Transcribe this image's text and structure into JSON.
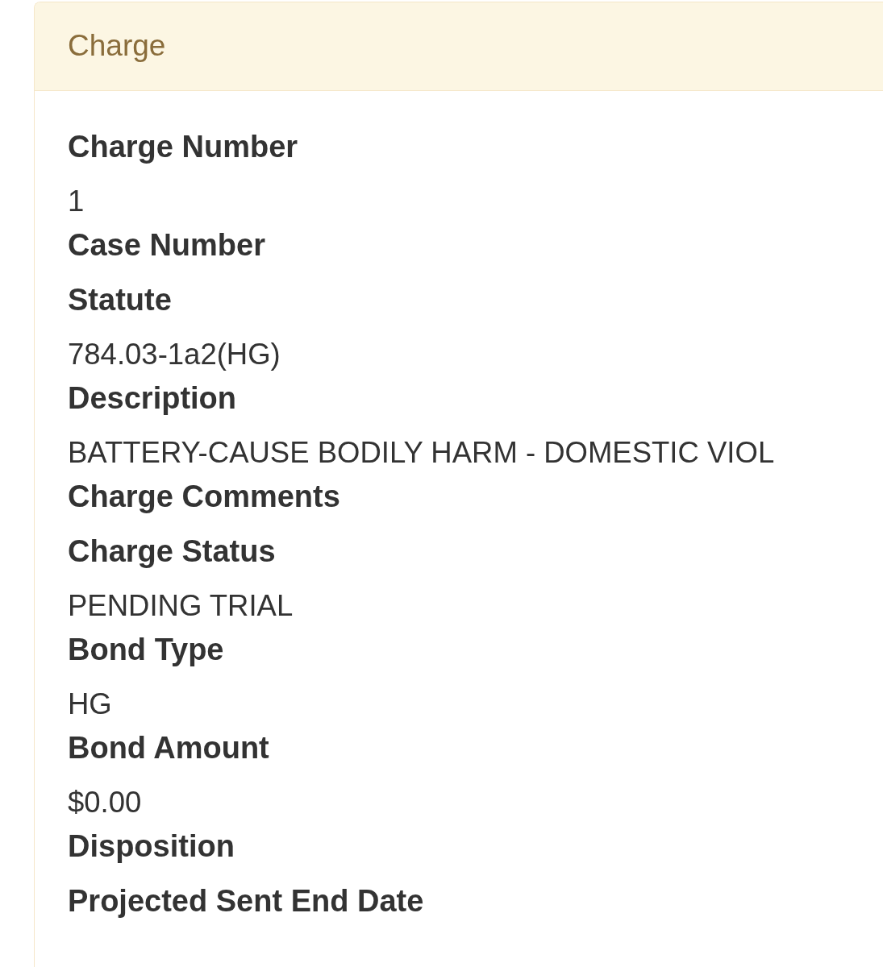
{
  "panel": {
    "title": "Charge",
    "fields": [
      {
        "label": "Charge Number",
        "value": "1"
      },
      {
        "label": "Case Number"
      },
      {
        "label": "Statute",
        "value": "784.03-1a2(HG)"
      },
      {
        "label": "Description",
        "value": "BATTERY-CAUSE BODILY HARM - DOMESTIC VIOL"
      },
      {
        "label": "Charge Comments"
      },
      {
        "label": "Charge Status",
        "value": "PENDING TRIAL"
      },
      {
        "label": "Bond Type",
        "value": "HG"
      },
      {
        "label": "Bond Amount",
        "value": "$0.00"
      },
      {
        "label": "Disposition"
      },
      {
        "label": "Projected Sent End Date"
      }
    ]
  }
}
